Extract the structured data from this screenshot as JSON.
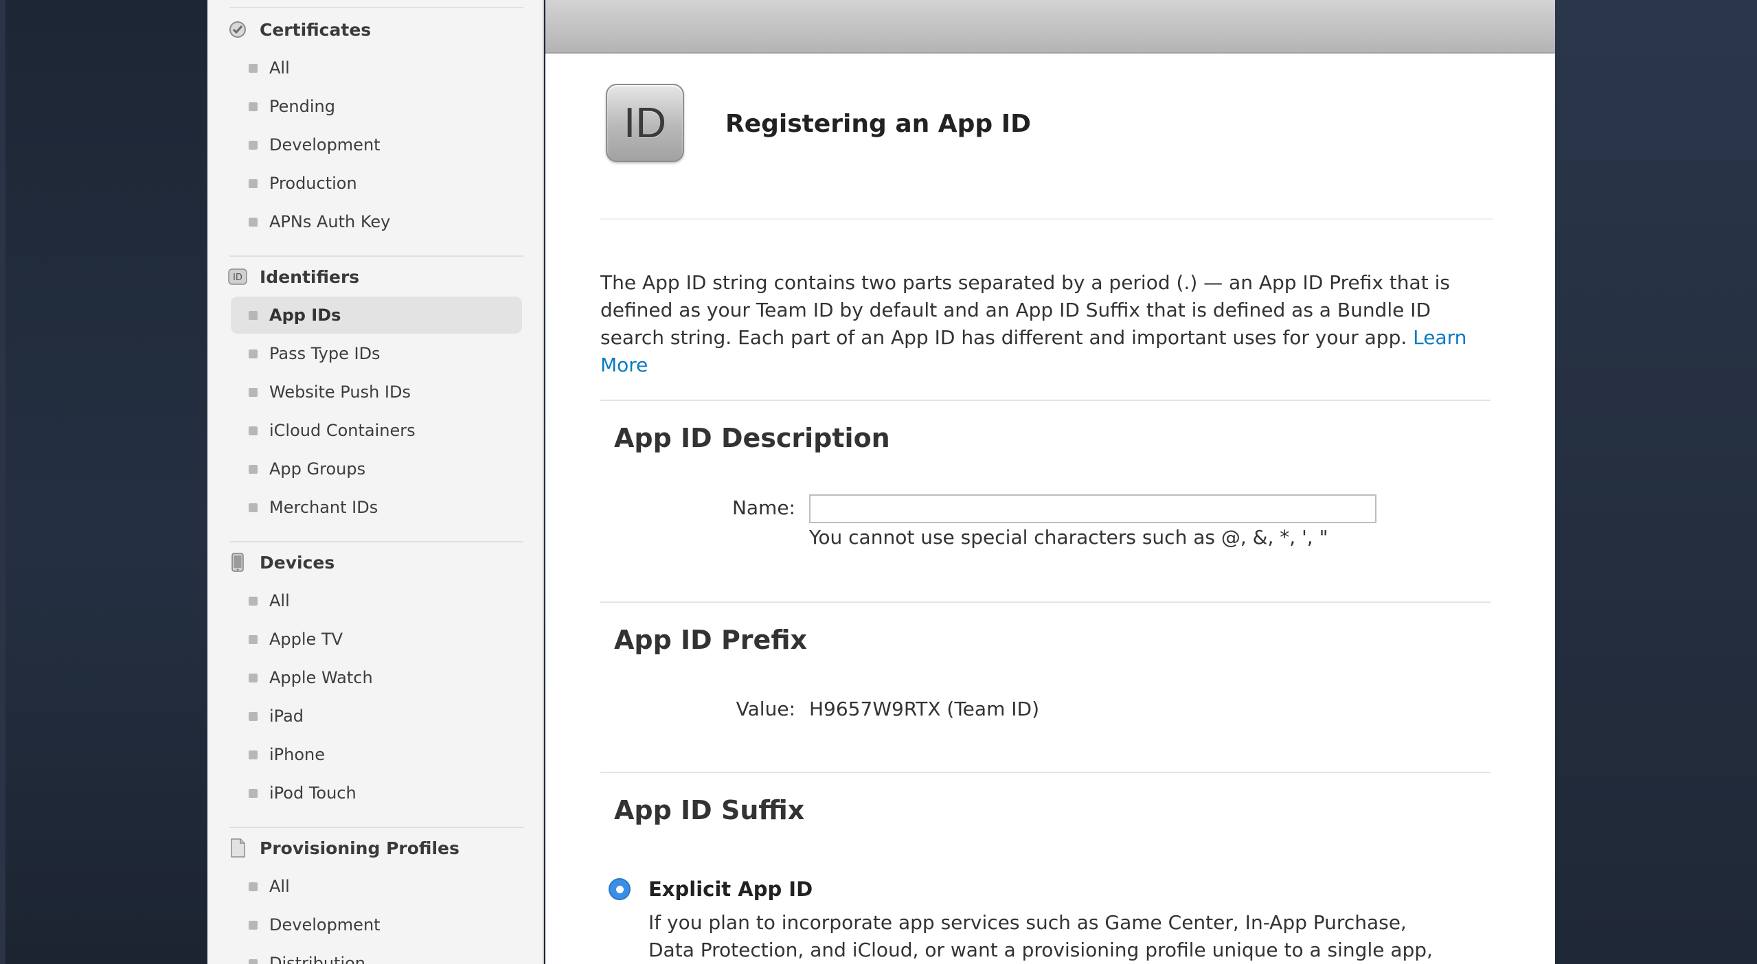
{
  "sidebar": {
    "certificates": {
      "title": "Certificates",
      "icon": "certificate-icon",
      "items": [
        "All",
        "Pending",
        "Development",
        "Production",
        "APNs Auth Key"
      ]
    },
    "identifiers": {
      "title": "Identifiers",
      "icon": "id-icon",
      "items": [
        "App IDs",
        "Pass Type IDs",
        "Website Push IDs",
        "iCloud Containers",
        "App Groups",
        "Merchant IDs"
      ],
      "active_item": "App IDs"
    },
    "devices": {
      "title": "Devices",
      "icon": "device-icon",
      "items": [
        "All",
        "Apple TV",
        "Apple Watch",
        "iPad",
        "iPhone",
        "iPod Touch"
      ]
    },
    "profiles": {
      "title": "Provisioning Profiles",
      "icon": "document-icon",
      "items": [
        "All",
        "Development",
        "Distribution"
      ]
    }
  },
  "main": {
    "icon_text": "ID",
    "title": "Registering an App ID",
    "intro_text": "The App ID string contains two parts separated by a period (.) — an App ID Prefix that is defined as your Team ID by default and an App ID Suffix that is defined as a Bundle ID search string. Each part of an App ID has different and important uses for your app.",
    "learn_more": "Learn More",
    "description": {
      "heading": "App ID Description",
      "name_label": "Name:",
      "name_value": "",
      "hint": "You cannot use special characters such as @, &, *, ', \""
    },
    "prefix": {
      "heading": "App ID Prefix",
      "value_label": "Value:",
      "value": "H9657W9RTX (Team ID)"
    },
    "suffix": {
      "heading": "App ID Suffix",
      "option_label": "Explicit App ID",
      "option_selected": true,
      "option_desc": "If you plan to incorporate app services such as Game Center, In-App Purchase, Data Protection, and iCloud, or want a provisioning profile unique to a single app, you must"
    }
  },
  "colors": {
    "link": "#0a7ac2",
    "radio": "#3b8ee6",
    "sidebar_bg": "#f4f4f4",
    "active_item_bg": "#e3e3e3"
  }
}
